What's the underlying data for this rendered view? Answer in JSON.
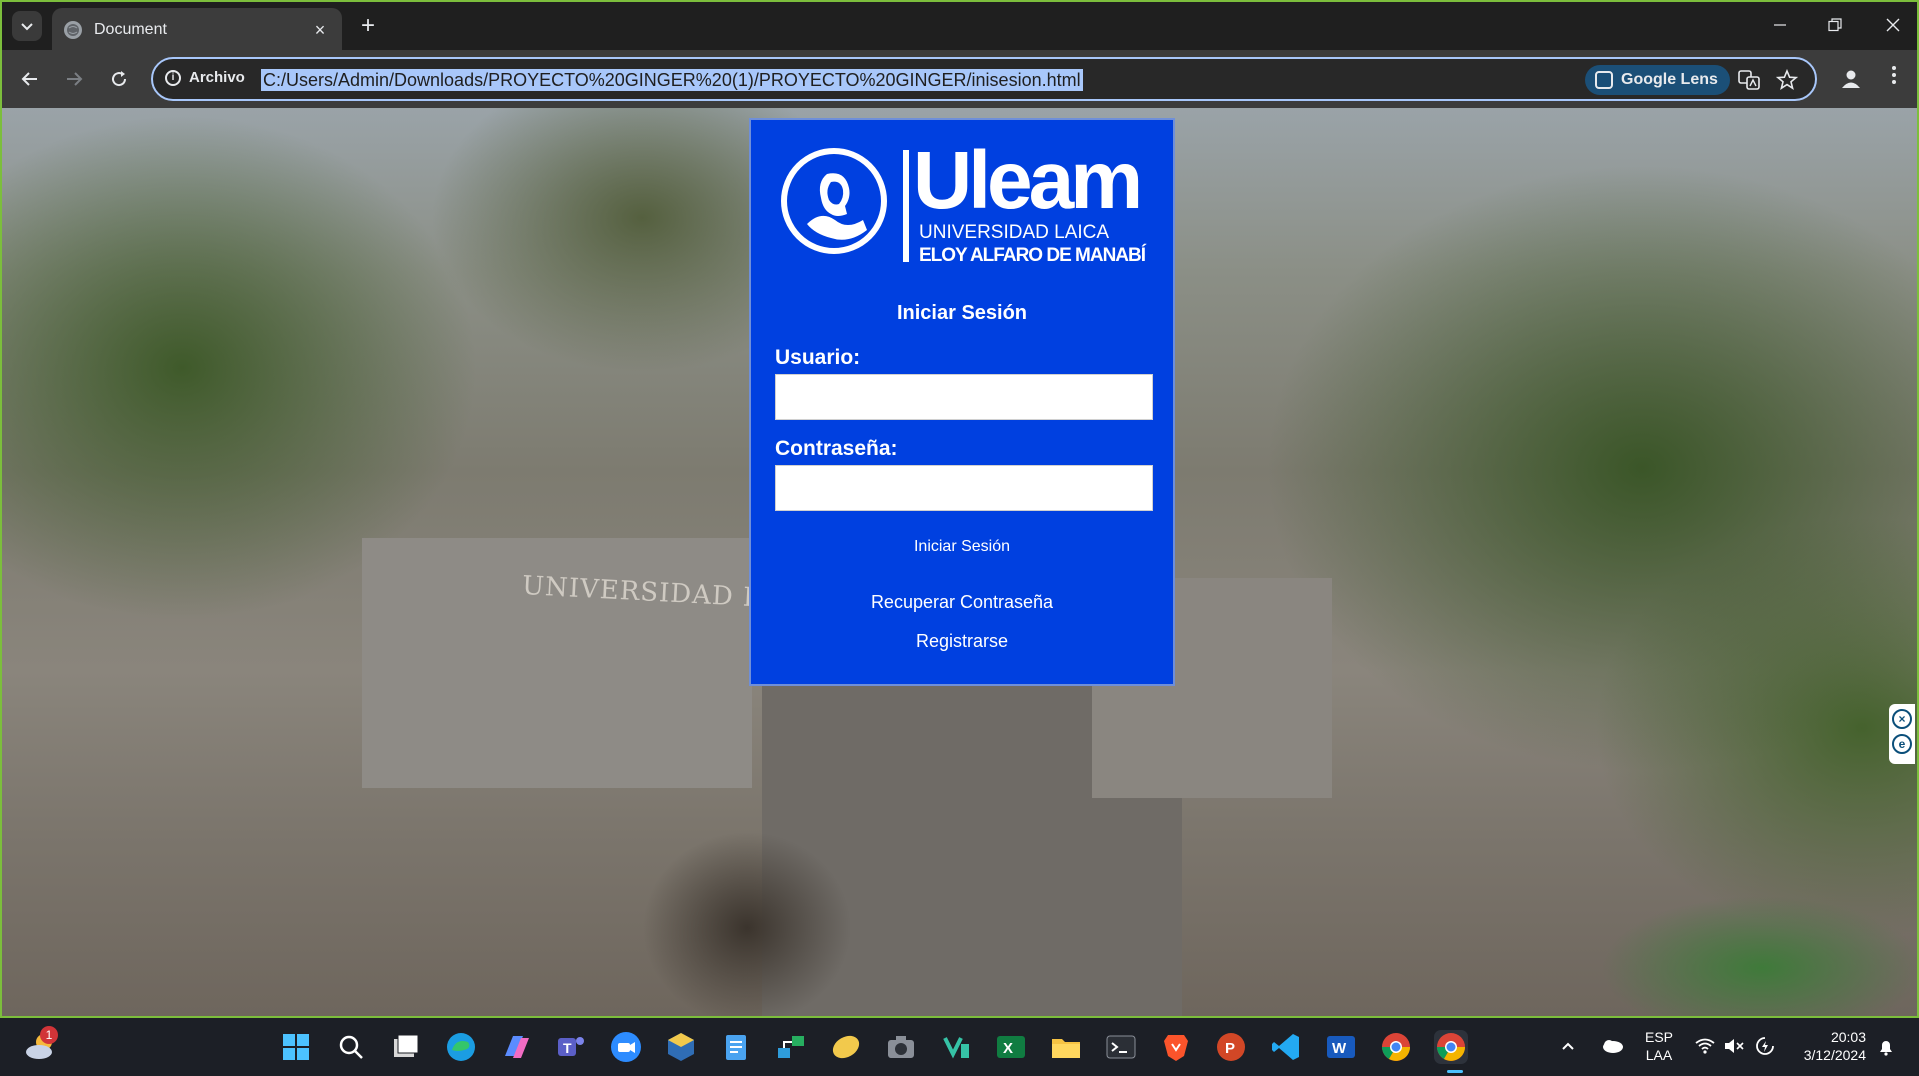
{
  "browser": {
    "tab_title": "Document",
    "tab_close": "×",
    "new_tab": "+",
    "site_info_label": "Archivo",
    "url": "C:/Users/Admin/Downloads/PROYECTO%20GINGER%20(1)/PROYECTO%20GINGER/inisesion.html",
    "lens_label": "Google Lens"
  },
  "background": {
    "sign_text": "UNIVERSIDAD LAI"
  },
  "login": {
    "logo_wordmark": "Uleam",
    "logo_line1": "UNIVERSIDAD LAICA",
    "logo_line2": "ELOY ALFARO DE MANABÍ",
    "heading": "Iniciar Sesión",
    "username_label": "Usuario:",
    "username_value": "",
    "password_label": "Contraseña:",
    "password_value": "",
    "submit_label": "Iniciar Sesión",
    "recover_link": "Recuperar Contraseña",
    "register_link": "Registrarse"
  },
  "taskbar": {
    "weather_badge": "1",
    "lang_primary": "ESP",
    "lang_secondary": "LAA",
    "time": "20:03",
    "date": "3/12/2024"
  },
  "colors": {
    "card_bg": "#0040e0",
    "url_highlight": "#a8c7fa",
    "window_border": "#7cbe3c",
    "taskbar_bg": "#1c1f26"
  }
}
